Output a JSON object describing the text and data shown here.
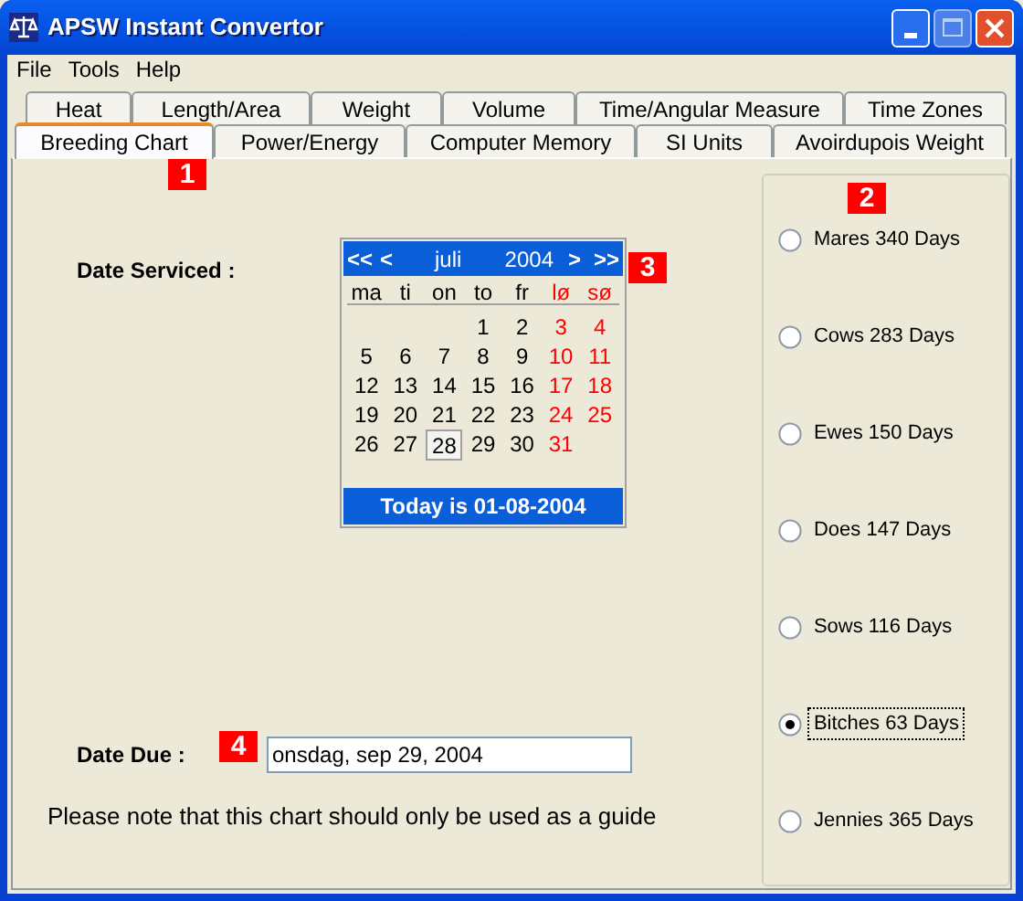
{
  "window": {
    "title": "APSW Instant Convertor"
  },
  "menu": [
    "File",
    "Tools",
    "Help"
  ],
  "tab_rows": [
    [
      {
        "label": "Heat",
        "selected": false
      },
      {
        "label": "Length/Area",
        "selected": false
      },
      {
        "label": "Weight",
        "selected": false
      },
      {
        "label": "Volume",
        "selected": false
      },
      {
        "label": "Time/Angular Measure",
        "selected": false
      },
      {
        "label": "Time Zones",
        "selected": false
      }
    ],
    [
      {
        "label": "Breeding Chart",
        "selected": true
      },
      {
        "label": "Power/Energy",
        "selected": false
      },
      {
        "label": "Computer Memory",
        "selected": false
      },
      {
        "label": "SI Units",
        "selected": false
      },
      {
        "label": "Avoirdupois Weight",
        "selected": false
      }
    ]
  ],
  "date_serviced": {
    "label": "Date Serviced :"
  },
  "calendar": {
    "nav_prev_year": "<<",
    "nav_prev": "<",
    "month": "juli",
    "year": "2004",
    "nav_next": ">",
    "nav_next_year": ">>",
    "weekdays": [
      "ma",
      "ti",
      "on",
      "to",
      "fr",
      "lø",
      "sø"
    ],
    "weeks": [
      {
        "starts_midweek": true,
        "days": [
          {
            "day": "1",
            "selected": false
          },
          {
            "day": "2",
            "selected": false
          },
          {
            "day": "3",
            "selected": false
          },
          {
            "day": "4",
            "selected": false
          }
        ]
      },
      {
        "days": [
          {
            "day": "5",
            "selected": false
          },
          {
            "day": "6",
            "selected": false
          },
          {
            "day": "7",
            "selected": false
          },
          {
            "day": "8",
            "selected": false
          },
          {
            "day": "9",
            "selected": false
          },
          {
            "day": "10",
            "selected": false
          },
          {
            "day": "11",
            "selected": false
          }
        ]
      },
      {
        "days": [
          {
            "day": "12",
            "selected": false
          },
          {
            "day": "13",
            "selected": false
          },
          {
            "day": "14",
            "selected": false
          },
          {
            "day": "15",
            "selected": false
          },
          {
            "day": "16",
            "selected": false
          },
          {
            "day": "17",
            "selected": false
          },
          {
            "day": "18",
            "selected": false
          }
        ]
      },
      {
        "days": [
          {
            "day": "19",
            "selected": false
          },
          {
            "day": "20",
            "selected": false
          },
          {
            "day": "21",
            "selected": false
          },
          {
            "day": "22",
            "selected": false
          },
          {
            "day": "23",
            "selected": false
          },
          {
            "day": "24",
            "selected": false
          },
          {
            "day": "25",
            "selected": false
          }
        ]
      },
      {
        "days": [
          {
            "day": "26",
            "selected": false
          },
          {
            "day": "27",
            "selected": false
          },
          {
            "day": "28",
            "selected": true
          },
          {
            "day": "29",
            "selected": false
          },
          {
            "day": "30",
            "selected": false
          },
          {
            "day": "31",
            "selected": false
          }
        ]
      }
    ],
    "today": "Today is 01-08-2004"
  },
  "date_due": {
    "label": "Date Due :",
    "value": "onsdag, sep 29, 2004"
  },
  "note": "Please note that this chart should only be used as a guide",
  "gestation_options": [
    {
      "label": "Mares 340 Days",
      "selected": false
    },
    {
      "label": "Cows 283 Days",
      "selected": false
    },
    {
      "label": "Ewes 150 Days",
      "selected": false
    },
    {
      "label": "Does 147 Days",
      "selected": false
    },
    {
      "label": "Sows 116 Days",
      "selected": false
    },
    {
      "label": "Bitches 63 Days",
      "selected": true
    },
    {
      "label": "Jennies 365 Days",
      "selected": false
    }
  ],
  "callouts": [
    "1",
    "2",
    "3",
    "4"
  ]
}
